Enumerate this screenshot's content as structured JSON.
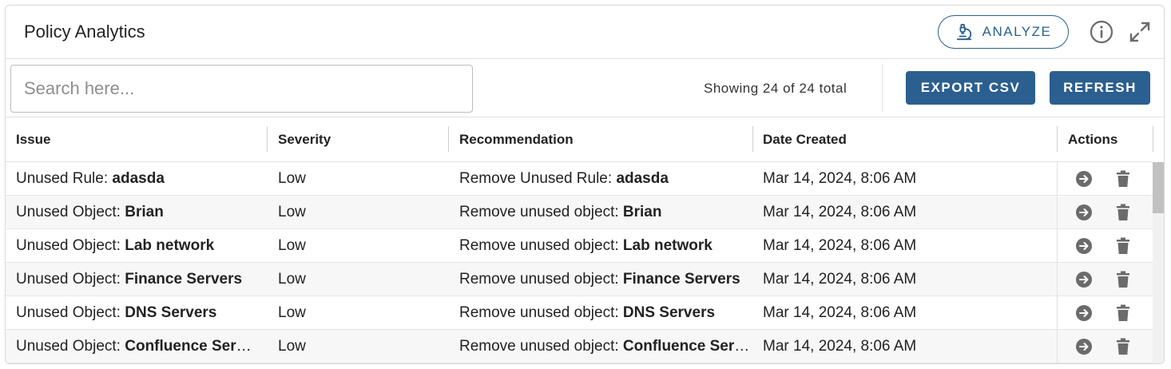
{
  "header": {
    "title": "Policy Analytics",
    "analyze_label": "ANALYZE",
    "analyze_icon": "microscope-icon",
    "info_icon": "info-icon",
    "expand_icon": "expand-icon"
  },
  "toolbar": {
    "search_placeholder": "Search here...",
    "showing_text": "Showing 24 of 24 total",
    "export_label": "EXPORT CSV",
    "refresh_label": "REFRESH"
  },
  "columns": {
    "issue": "Issue",
    "severity": "Severity",
    "recommendation": "Recommendation",
    "date": "Date Created",
    "actions": "Actions"
  },
  "rows": [
    {
      "issue_prefix": "Unused Rule: ",
      "issue_name": "adasda",
      "severity": "Low",
      "rec_prefix": "Remove Unused Rule: ",
      "rec_name": "adasda",
      "date": "Mar 14, 2024, 8:06 AM"
    },
    {
      "issue_prefix": "Unused Object: ",
      "issue_name": "Brian",
      "severity": "Low",
      "rec_prefix": "Remove unused object: ",
      "rec_name": "Brian",
      "date": "Mar 14, 2024, 8:06 AM"
    },
    {
      "issue_prefix": "Unused Object: ",
      "issue_name": "Lab network",
      "severity": "Low",
      "rec_prefix": "Remove unused object: ",
      "rec_name": "Lab network",
      "date": "Mar 14, 2024, 8:06 AM"
    },
    {
      "issue_prefix": "Unused Object: ",
      "issue_name": "Finance Servers",
      "severity": "Low",
      "rec_prefix": "Remove unused object: ",
      "rec_name": "Finance Servers",
      "date": "Mar 14, 2024, 8:06 AM"
    },
    {
      "issue_prefix": "Unused Object: ",
      "issue_name": "DNS Servers",
      "severity": "Low",
      "rec_prefix": "Remove unused object: ",
      "rec_name": "DNS Servers",
      "date": "Mar 14, 2024, 8:06 AM"
    },
    {
      "issue_prefix": "Unused Object: ",
      "issue_name": "Confluence Servers",
      "severity": "Low",
      "rec_prefix": "Remove unused object: ",
      "rec_name": "Confluence Servers",
      "date": "Mar 14, 2024, 8:06 AM"
    }
  ],
  "row_actions": {
    "go_icon": "arrow-circle-right-icon",
    "delete_icon": "trash-icon"
  },
  "colors": {
    "accent": "#2b5f8f",
    "icon_gray": "#6b6b6b"
  }
}
